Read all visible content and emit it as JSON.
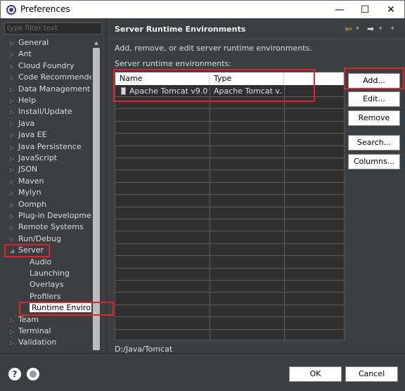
{
  "window": {
    "title": "Preferences",
    "minimize": "—",
    "maximize": "☐",
    "close": "✕"
  },
  "filter": {
    "placeholder": "type filter text"
  },
  "tree": {
    "items": [
      {
        "label": "General",
        "level": 0,
        "arrow": "▷"
      },
      {
        "label": "Ant",
        "level": 0,
        "arrow": "▷"
      },
      {
        "label": "Cloud Foundry",
        "level": 0,
        "arrow": "▷"
      },
      {
        "label": "Code Recommenders",
        "level": 0,
        "arrow": "▷"
      },
      {
        "label": "Data Management",
        "level": 0,
        "arrow": "▷"
      },
      {
        "label": "Help",
        "level": 0,
        "arrow": "▷"
      },
      {
        "label": "Install/Update",
        "level": 0,
        "arrow": "▷"
      },
      {
        "label": "Java",
        "level": 0,
        "arrow": "▷"
      },
      {
        "label": "Java EE",
        "level": 0,
        "arrow": "▷"
      },
      {
        "label": "Java Persistence",
        "level": 0,
        "arrow": "▷"
      },
      {
        "label": "JavaScript",
        "level": 0,
        "arrow": "▷"
      },
      {
        "label": "JSON",
        "level": 0,
        "arrow": "▷"
      },
      {
        "label": "Maven",
        "level": 0,
        "arrow": "▷"
      },
      {
        "label": "Mylyn",
        "level": 0,
        "arrow": "▷"
      },
      {
        "label": "Oomph",
        "level": 0,
        "arrow": "▷"
      },
      {
        "label": "Plug-in Development",
        "level": 0,
        "arrow": "▷"
      },
      {
        "label": "Remote Systems",
        "level": 0,
        "arrow": "▷"
      },
      {
        "label": "Run/Debug",
        "level": 0,
        "arrow": "▷"
      },
      {
        "label": "Server",
        "level": 0,
        "arrow": "◢"
      },
      {
        "label": "Audio",
        "level": 1,
        "arrow": ""
      },
      {
        "label": "Launching",
        "level": 1,
        "arrow": ""
      },
      {
        "label": "Overlays",
        "level": 1,
        "arrow": ""
      },
      {
        "label": "Profilers",
        "level": 1,
        "arrow": ""
      },
      {
        "label": "Runtime Environments",
        "level": 1,
        "arrow": "",
        "selected": true
      },
      {
        "label": "Team",
        "level": 0,
        "arrow": "▷"
      },
      {
        "label": "Terminal",
        "level": 0,
        "arrow": "▷"
      },
      {
        "label": "Validation",
        "level": 0,
        "arrow": "▷"
      }
    ]
  },
  "page": {
    "title": "Server Runtime Environments",
    "description": "Add, remove, or edit server runtime environments.",
    "list_label": "Server runtime environments:",
    "columns": [
      "Name",
      "Type"
    ],
    "rows": [
      {
        "name": "Apache Tomcat v9.0",
        "type": "Apache Tomcat v..."
      }
    ],
    "path": "D:/Java/Tomcat"
  },
  "nav": {
    "back": "⇦",
    "forward": "➡",
    "dropdown": "▾",
    "menu": "▾"
  },
  "buttons": {
    "add": "Add...",
    "edit": "Edit...",
    "remove": "Remove",
    "search": "Search...",
    "columns": "Columns..."
  },
  "footer": {
    "help": "?",
    "ok": "OK",
    "cancel": "Cancel"
  },
  "colors": {
    "highlight": "#e8202a",
    "background": "#3c3f41",
    "accent_arrow": "#f0c040"
  }
}
